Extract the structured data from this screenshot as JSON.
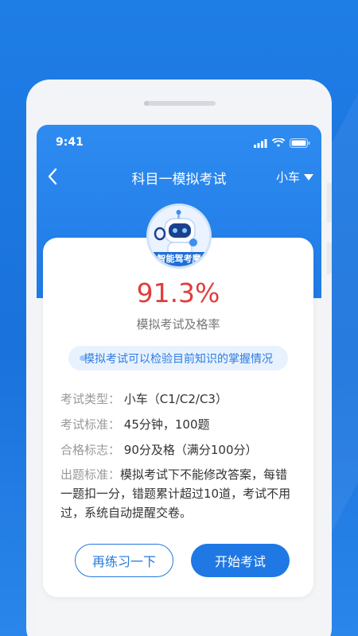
{
  "status_bar": {
    "time": "9:41"
  },
  "nav": {
    "title": "科目一模拟考试",
    "vehicle": "小车"
  },
  "avatar": {
    "caption": "智能驾考魔"
  },
  "result": {
    "rate": "91.3%",
    "rate_label": "模拟考试及格率"
  },
  "tip": "模拟考试可以检验目前知识的掌握情况",
  "info": {
    "type_label": "考试类型：",
    "type_value": "小车（C1/C2/C3）",
    "standard_label": "考试标准：",
    "standard_value": "45分钟，100题",
    "pass_label": "合格标志：",
    "pass_value": "90分及格（满分100分）",
    "rule_label": "出题标准：",
    "rule_value": "模拟考试下不能修改答案，每错一题扣一分，错题累计超过10道，考试不用过，系统自动提醒交卷。"
  },
  "buttons": {
    "retry": "再练习一下",
    "start": "开始考试"
  },
  "colors": {
    "brand_blue": "#1f78e4",
    "rate_red": "#e23c3c"
  },
  "icons": [
    "back-icon",
    "signal-icon",
    "wifi-icon",
    "battery-icon",
    "dropdown-triangle-icon",
    "robot-avatar-icon"
  ]
}
